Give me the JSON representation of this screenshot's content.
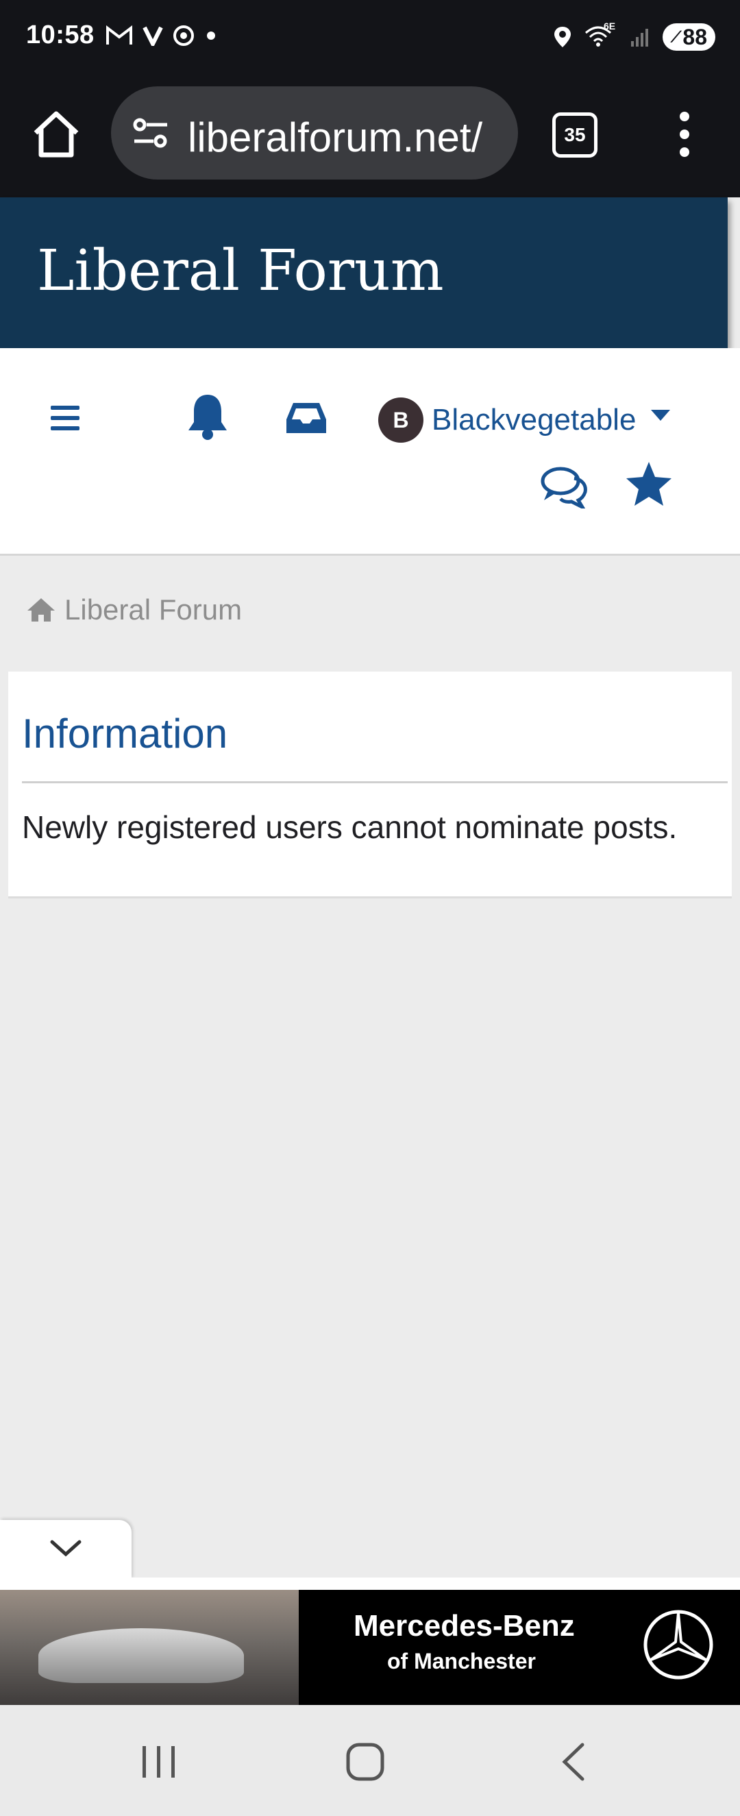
{
  "status": {
    "time": "10:58",
    "battery": "88",
    "left_icons": [
      "gmail-icon",
      "v-icon",
      "chrome-icon",
      "dot-icon"
    ],
    "right_icons": [
      "location-icon",
      "wifi-6e-icon",
      "signal-icon",
      "battery-icon"
    ],
    "wifi_label": "6E"
  },
  "browser": {
    "url": "liberalforum.net/",
    "tab_count": "35"
  },
  "forum": {
    "title": "Liberal Forum"
  },
  "nav": {
    "avatar_letter": "B",
    "username": "Blackvegetable"
  },
  "breadcrumb": {
    "label": "Liberal Forum"
  },
  "info": {
    "title": "Information",
    "message": "Newly registered users cannot nominate posts."
  },
  "ad": {
    "brand": "Mercedes-Benz",
    "subline": "of Manchester"
  },
  "colors": {
    "header_bg": "#123653",
    "link_blue": "#185292",
    "page_bg": "#ececec"
  }
}
